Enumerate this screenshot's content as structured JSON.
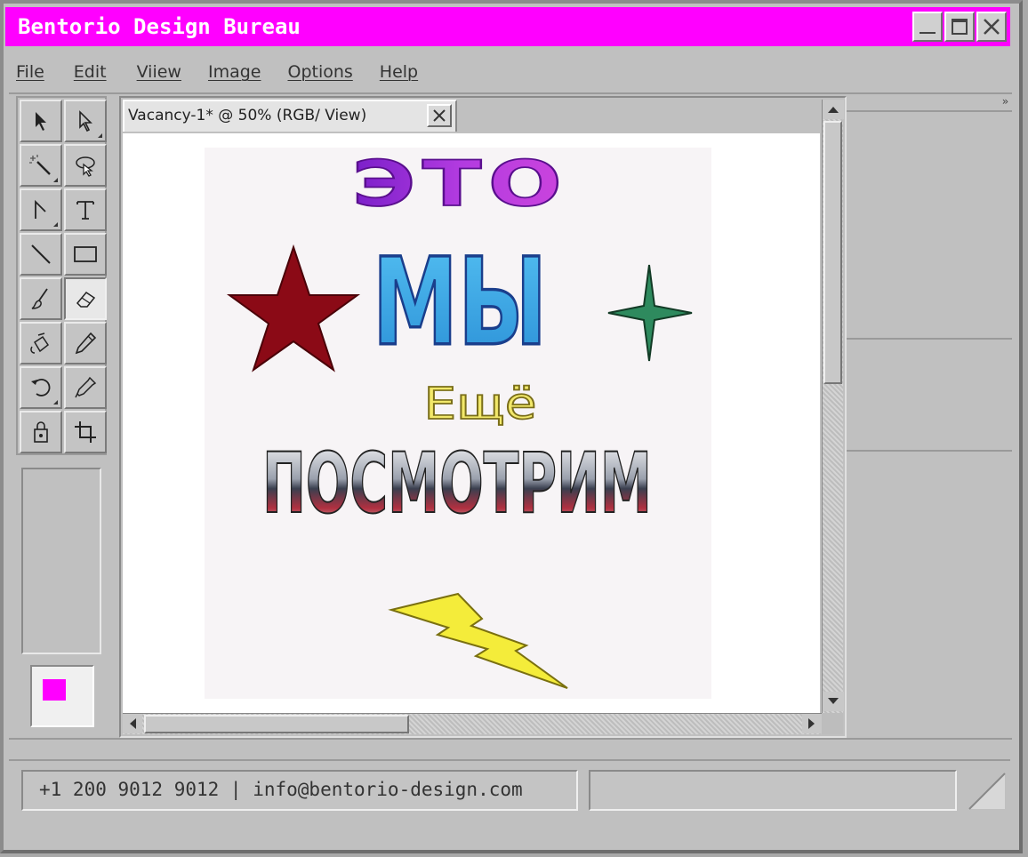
{
  "window": {
    "title": "Bentorio Design Bureau",
    "accent_color": "#ff00ff",
    "controls": [
      "minimize-icon",
      "maximize-icon",
      "close-icon"
    ]
  },
  "menu": {
    "items": [
      "File",
      "Edit",
      "Viiew",
      "Image",
      "Options",
      "Help"
    ]
  },
  "tools": [
    "select-arrow-icon",
    "direct-select-icon",
    "magic-wand-icon",
    "lasso-icon",
    "pen-node-icon",
    "text-tool-icon",
    "line-tool-icon",
    "rectangle-tool-icon",
    "brush-icon",
    "eraser-icon",
    "paint-bucket-icon",
    "pencil-icon",
    "rotate-icon",
    "eyedropper-icon",
    "lock-icon",
    "crop-icon"
  ],
  "active_tool": "eraser-icon",
  "colors": {
    "foreground": "#ff00ff",
    "background": "#555555"
  },
  "document": {
    "tab_label": "Vacancy-1* @ 50% (RGB/ View)",
    "artwork": {
      "line1": "ЭТО",
      "line2": "МЫ",
      "line3": "Ещё",
      "line4": "ПОСМОТРИМ"
    }
  },
  "status": {
    "contact": "+1 200 9012 9012 | info@bentorio-design.com",
    "secondary": ""
  }
}
